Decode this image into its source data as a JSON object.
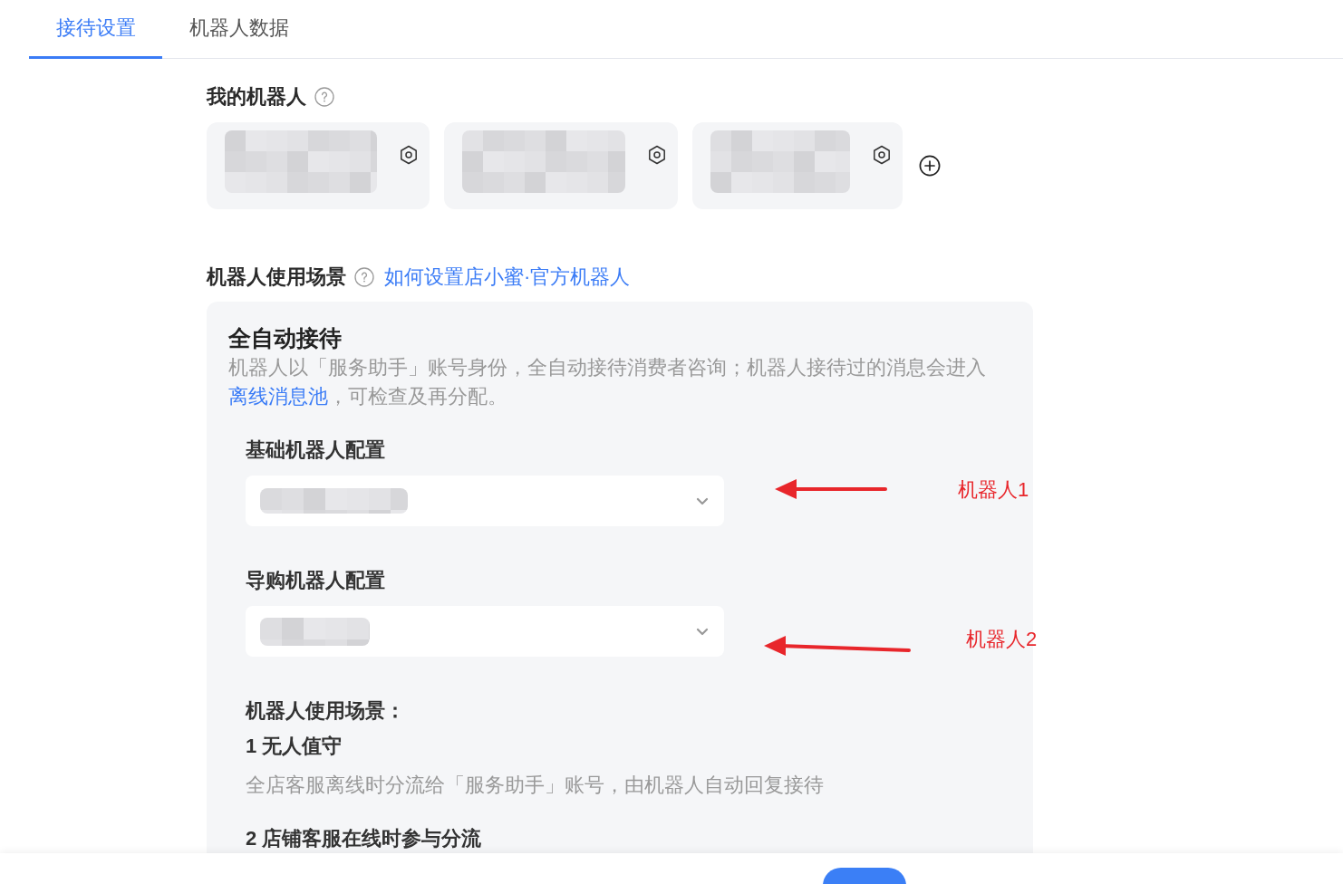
{
  "tabs": [
    {
      "label": "接待设置",
      "selected": true
    },
    {
      "label": "机器人数据",
      "selected": false
    }
  ],
  "my_robots": {
    "title": "我的机器人",
    "robots": [
      {
        "kind": "blurred"
      },
      {
        "kind": "blurred"
      },
      {
        "kind": "blurred"
      }
    ]
  },
  "scenario": {
    "title": "机器人使用场景",
    "help_link": "如何设置店小蜜·官方机器人",
    "mode": {
      "title": "全自动接待",
      "description": {
        "before": "机器人以「服务助手」账号身份，全自动接待消费者咨询；机器人接待过的消息会进入",
        "link": "离线消息池",
        "after": "，可检查及再分配。"
      }
    },
    "configs": [
      {
        "label": "基础机器人配置",
        "kind": "blurred",
        "annotation": "机器人1"
      },
      {
        "label": "导购机器人配置",
        "kind": "blurred",
        "annotation": "机器人2"
      }
    ],
    "usage": {
      "title": "机器人使用场景：",
      "items": [
        {
          "title": "1 无人值守",
          "description": "全店客服离线时分流给「服务助手」账号，由机器人自动回复接待"
        },
        {
          "title": "2 店铺客服在线时参与分流"
        }
      ]
    }
  }
}
